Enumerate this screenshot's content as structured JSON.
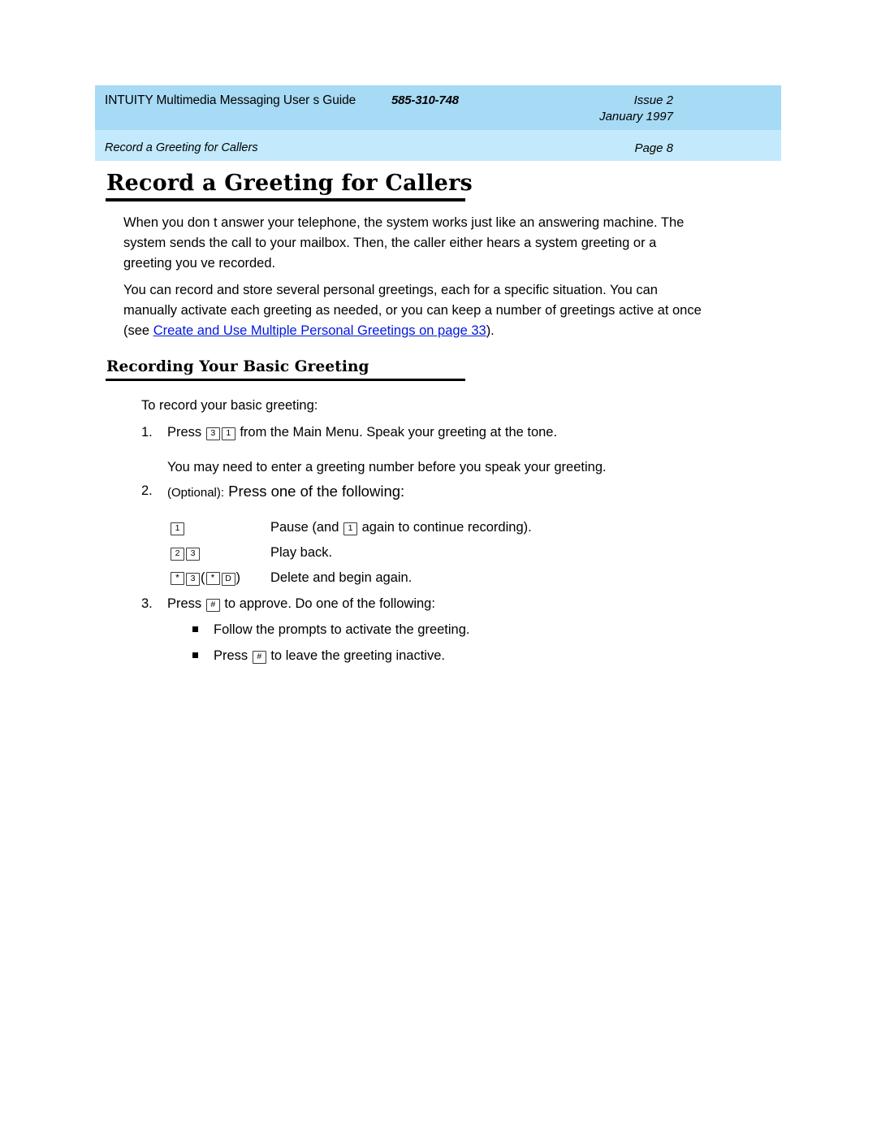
{
  "document": {
    "header": {
      "guide_title": "INTUITY Multimedia Messaging User s Guide",
      "doc_number": "585-310-748",
      "issue": "Issue 2",
      "date": "January 1997",
      "section_name": "Record a Greeting for Callers",
      "page_label": "Page 8",
      "band_top_color": "#a7daf5",
      "band_bottom_color": "#c3eafc"
    },
    "title": "Record a Greeting for Callers",
    "intro_paragraph_1": "When you don t answer your telephone, the system works just like an answering machine. The system sends the call to your mailbox. Then, the caller either hears a system greeting or a greeting you ve recorded.",
    "intro_paragraph_2": {
      "before_link": "You can record and store several personal greetings, each for a specific situation. You can manually activate each greeting as needed, or you can keep a number of greetings active at once (see ",
      "link_text": " Create and Use Multiple Personal Greetings  on page 33",
      "after_link": ").",
      "link_color": "#0018e0"
    },
    "subheading": "Recording Your Basic Greeting",
    "lead_in": "To record your basic greeting:",
    "steps": [
      {
        "number": "1.",
        "text_before_keys": "Press ",
        "keys": [
          "3",
          "1"
        ],
        "text_after_keys": " from the Main Menu. Speak your greeting at the tone."
      },
      {
        "number": "2.",
        "optional_label": "(Optional):",
        "text": " Press one of the following:"
      },
      {
        "number": "3.",
        "text_before_keys": "Press ",
        "keys": [
          "#"
        ],
        "text_after_keys": " to approve. Do one of the following:"
      }
    ],
    "step1_note": "You may need to enter a greeting number before you speak your greeting.",
    "option_rows": [
      {
        "keys": [
          "1"
        ],
        "description_before_key": "Pause (and ",
        "inline_key": "1",
        "description_after_key": " again to continue recording)."
      },
      {
        "keys": [
          "2",
          "3"
        ],
        "description_before_key": "Play back.",
        "inline_key": "",
        "description_after_key": ""
      },
      {
        "keys": [
          "*",
          "3"
        ],
        "alt_open": "(",
        "alt_keys": [
          "*",
          "D"
        ],
        "alt_close": ")",
        "description_before_key": "Delete and begin again.",
        "inline_key": "",
        "description_after_key": ""
      }
    ],
    "bullets": [
      {
        "text_before_keys": "Follow the prompts to activate the greeting.",
        "keys": [],
        "text_after_keys": ""
      },
      {
        "text_before_keys": "Press ",
        "keys": [
          "#"
        ],
        "text_after_keys": " to leave the greeting inactive."
      }
    ]
  }
}
